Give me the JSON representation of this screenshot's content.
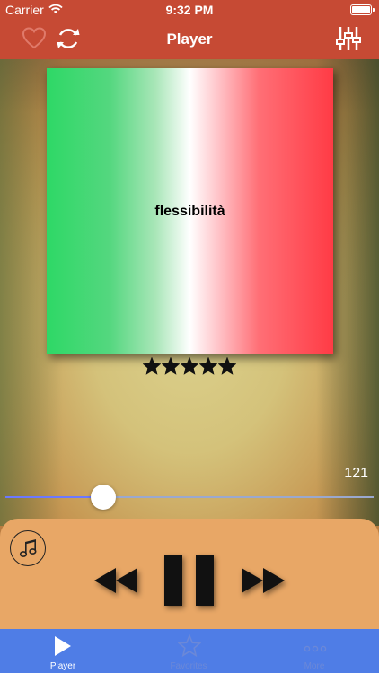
{
  "status_bar": {
    "carrier": "Carrier",
    "time": "9:32 PM"
  },
  "nav": {
    "title": "Player",
    "left_icons": [
      "heart-icon",
      "refresh-icon"
    ],
    "right_icon": "equalizer-icon"
  },
  "album": {
    "word": "flessibilità",
    "gradient_colors": [
      "#2ed866",
      "#ffffff",
      "#ff3b45"
    ]
  },
  "rating": {
    "stars": 5,
    "max_stars": 5
  },
  "track": {
    "play_count": "121",
    "progress": 0.265
  },
  "controls": {
    "icons": [
      "music-note-icon",
      "rewind-icon",
      "pause-icon",
      "fast-forward-icon"
    ]
  },
  "tabs": [
    {
      "label": "Player",
      "icon": "play-icon",
      "active": true
    },
    {
      "label": "Favorites",
      "icon": "star-icon",
      "active": false
    },
    {
      "label": "More",
      "icon": "more-icon",
      "active": false
    }
  ],
  "colors": {
    "nav_bar": "#c64a34",
    "tab_bar": "#4f7de6",
    "controls_panel": "#e8a766",
    "slider_fill": "#6b78ff"
  }
}
